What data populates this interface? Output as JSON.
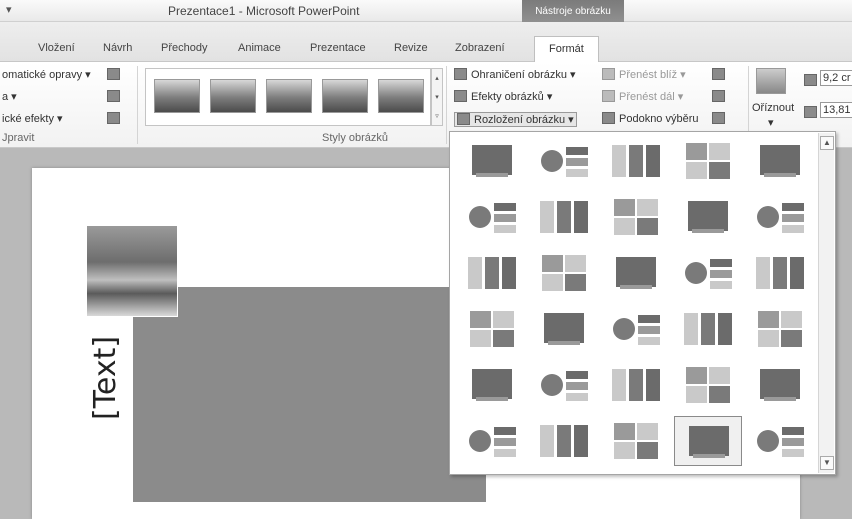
{
  "window": {
    "qat_glyph": "▾",
    "title": "Prezentace1 - Microsoft PowerPoint",
    "tools_badge": "Nástroje obrázku"
  },
  "tabs": [
    "Vložení",
    "Návrh",
    "Přechody",
    "Animace",
    "Prezentace",
    "Revize",
    "Zobrazení"
  ],
  "active_tab": "Formát",
  "ribbon": {
    "adjust": {
      "items": [
        "omatické opravy ▾",
        "a ▾",
        "ické efekty ▾"
      ],
      "label": "Jpravit"
    },
    "styles": {
      "label": "Styly obrázků",
      "thumb_count": 6
    },
    "picture_cmds": [
      "Ohraničení obrázku ▾",
      "Efekty obrázků ▾",
      "Rozložení obrázku ▾"
    ],
    "arrange_cmds": [
      "Přenést blíž ▾",
      "Přenést dál ▾",
      "Podokno výběru"
    ],
    "crop": {
      "label": "Oříznout",
      "caret": "▾"
    },
    "size": {
      "height": "9,2 cr",
      "width": "13,81"
    }
  },
  "slide": {
    "placeholder_text": "[Text]"
  },
  "dropdown": {
    "rows": 6,
    "cols": 5,
    "selected_row": 5,
    "selected_col": 3,
    "scroll_up": "▲",
    "scroll_down": "▼"
  },
  "colors": {
    "dark": "#6b6b6b",
    "mid": "#9a9a9a",
    "light": "#c9c9c9",
    "accent": "#7a7a7a"
  }
}
